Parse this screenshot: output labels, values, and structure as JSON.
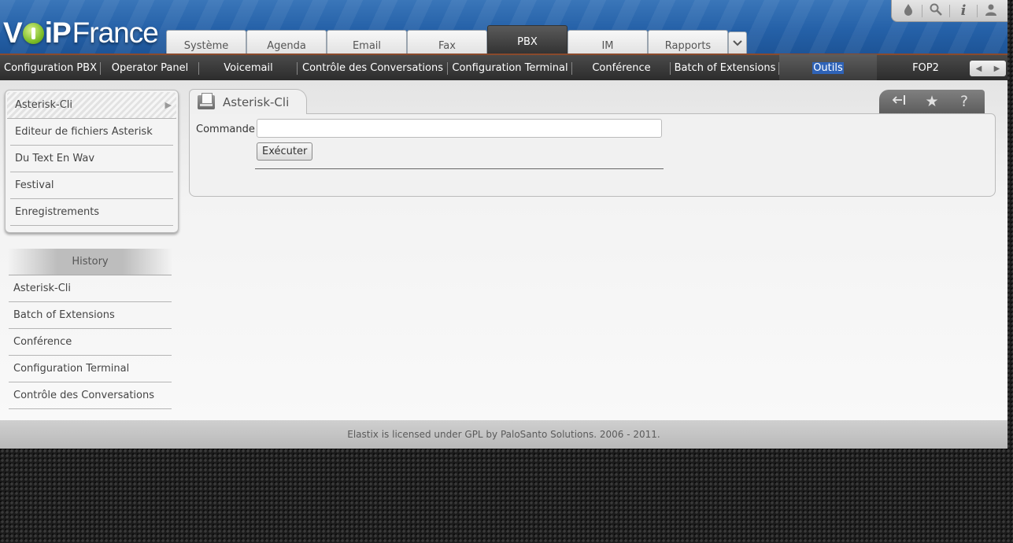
{
  "header": {
    "logo": {
      "part1": "V",
      "part2": "iP",
      "part3": "France"
    },
    "tabs": [
      {
        "label": "Système",
        "active": false
      },
      {
        "label": "Agenda",
        "active": false
      },
      {
        "label": "Email",
        "active": false
      },
      {
        "label": "Fax",
        "active": false
      },
      {
        "label": "PBX",
        "active": true
      },
      {
        "label": "IM",
        "active": false
      },
      {
        "label": "Rapports",
        "active": false
      }
    ],
    "more_icon": "chevron-down-icon",
    "utility_icons": [
      "theme-drop-icon",
      "search-icon",
      "info-icon",
      "user-icon"
    ]
  },
  "submenu": {
    "items": [
      {
        "label": "Configuration PBX",
        "active": false
      },
      {
        "label": "Operator Panel",
        "active": false
      },
      {
        "label": "Voicemail",
        "active": false
      },
      {
        "label": "Contrôle des Conversations",
        "active": false
      },
      {
        "label": "Configuration Terminal",
        "active": false
      },
      {
        "label": "Conférence",
        "active": false
      },
      {
        "label": "Batch of Extensions",
        "active": false
      },
      {
        "label": "Outils",
        "active": true
      },
      {
        "label": "FOP2",
        "active": false
      }
    ],
    "scroll_icons": [
      "arrow-left-icon",
      "arrow-right-icon"
    ]
  },
  "sidebar": {
    "items": [
      {
        "label": "Asterisk-Cli",
        "selected": true
      },
      {
        "label": "Editeur de fichiers Asterisk",
        "selected": false
      },
      {
        "label": "Du Text En Wav",
        "selected": false
      },
      {
        "label": "Festival",
        "selected": false
      },
      {
        "label": "Enregistrements",
        "selected": false
      }
    ]
  },
  "history": {
    "title": "History",
    "items": [
      "Asterisk-Cli",
      "Batch of Extensions",
      "Conférence",
      "Configuration Terminal",
      "Contrôle des Conversations"
    ]
  },
  "module": {
    "title": "Asterisk-Cli",
    "tools": [
      "collapse-left-icon",
      "star-icon",
      "help-icon"
    ],
    "form": {
      "command_label": "Commande",
      "command_value": "",
      "execute_label": "Exécuter"
    }
  },
  "footer": {
    "text": "Elastix is licensed under GPL by PaloSanto Solutions. 2006 - 2011."
  },
  "colors": {
    "header_blue": "#2561a8",
    "submenu_dark": "#333333",
    "selection_blue": "#2f63b7"
  }
}
